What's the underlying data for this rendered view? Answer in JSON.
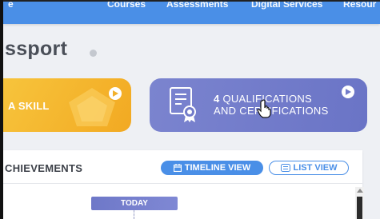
{
  "topnav": {
    "items": [
      "e",
      "Courses",
      "Assessments",
      "Digital Services",
      "Resour"
    ]
  },
  "page": {
    "title": "ssport"
  },
  "cards": {
    "skill": {
      "label": "A SKILL"
    },
    "qualifications": {
      "count": "4",
      "line1_rest": " QUALIFICATIONS",
      "line2": "AND CERTIFICATIONS"
    }
  },
  "achievements": {
    "title": "CHIEVEMENTS",
    "timeline_view_label": "TIMELINE VIEW",
    "list_view_label": "LIST VIEW",
    "today_label": "TODAY"
  },
  "colors": {
    "nav": "#4a8fe7",
    "skill_card": "#f2b12c",
    "qual_card": "#737cca",
    "accent": "#4a8fe7"
  },
  "icons": [
    "info-icon",
    "play-icon",
    "certificate-icon",
    "calendar-icon",
    "list-icon",
    "hand-cursor-icon"
  ]
}
